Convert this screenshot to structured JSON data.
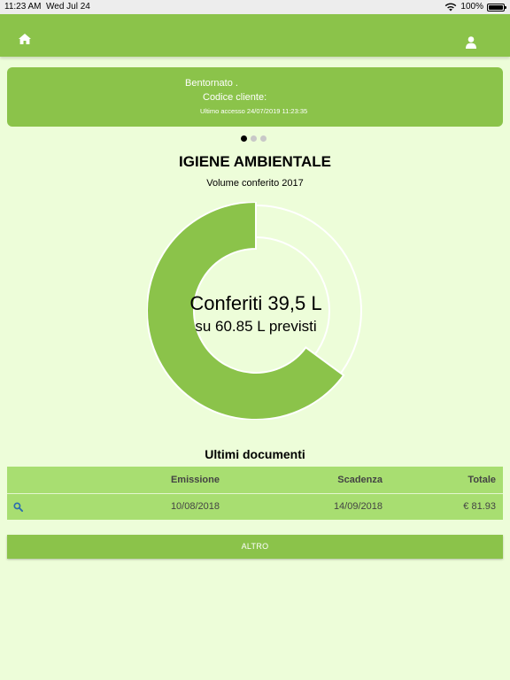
{
  "status_bar": {
    "time": "11:23 AM",
    "date": "Wed Jul 24",
    "battery": "100%"
  },
  "header": {
    "home_icon": "home-icon",
    "user_icon": "user-icon",
    "background": "#8bc34a"
  },
  "welcome": {
    "greeting": "Bentornato .",
    "customer_code": "Codice cliente:",
    "last_access": "Ultimo accesso 24/07/2019 11:23:35"
  },
  "carousel": {
    "pages": 3,
    "active": 0
  },
  "section": {
    "title": "IGIENE AMBIENTALE",
    "subtitle": "Volume conferito 2017"
  },
  "chart_data": {
    "type": "pie",
    "variant": "donut",
    "consumed": 39.5,
    "expected": 60.85,
    "label_main": "Conferiti 39,5 L",
    "label_sub": "su 60.85 L previsti",
    "fill_color": "#8bc34a",
    "track_color": "#ffffff"
  },
  "documents": {
    "title": "Ultimi documenti",
    "columns": [
      "Emissione",
      "Scadenza",
      "Totale"
    ],
    "rows": [
      {
        "emissione": "10/08/2018",
        "scadenza": "14/09/2018",
        "totale": "€ 81.93"
      }
    ],
    "row_icon": "search-icon"
  },
  "more_button": "ALTRO"
}
